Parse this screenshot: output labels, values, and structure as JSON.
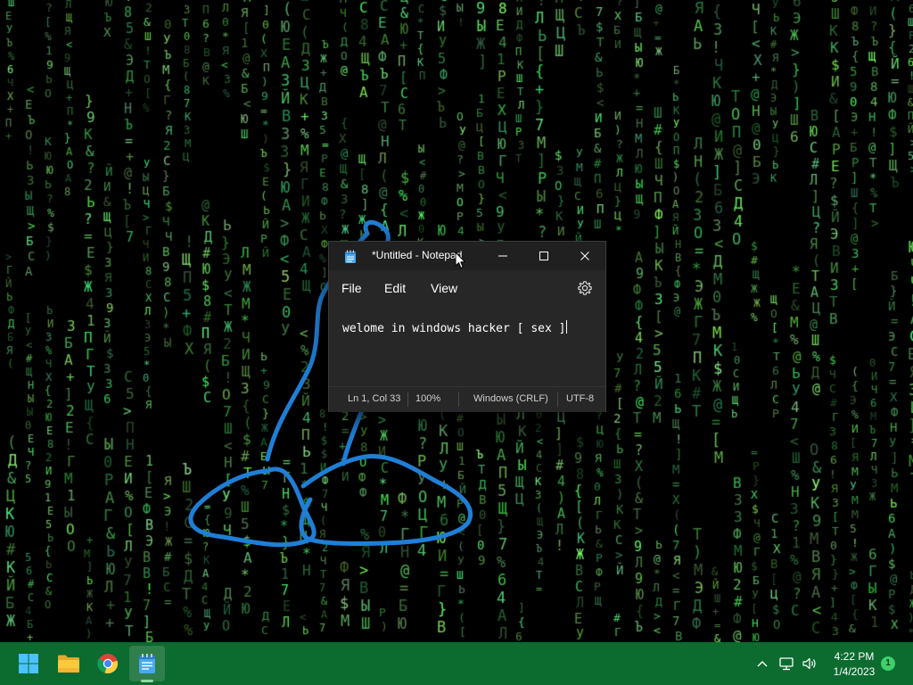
{
  "notepad": {
    "title": "*Untitled - Notepad",
    "menu": {
      "file": "File",
      "edit": "Edit",
      "view": "View"
    },
    "content": "welome in windows hacker [ sex ]",
    "status": {
      "position": "Ln 1, Col 33",
      "zoom": "100%",
      "line_ending": "Windows (CRLF)",
      "encoding": "UTF-8"
    }
  },
  "taskbar": {
    "pinned": [
      {
        "name": "start",
        "icon": "windows-logo-icon"
      },
      {
        "name": "file-explorer",
        "icon": "folder-icon"
      },
      {
        "name": "chrome",
        "icon": "chrome-icon"
      },
      {
        "name": "notepad",
        "icon": "notepad-icon",
        "active": true
      }
    ],
    "tray": {
      "time": "4:22 PM",
      "date": "1/4/2023",
      "notification_count": "1"
    }
  },
  "colors": {
    "taskbar": "#0c6b2f",
    "matrix_green": "#5cff7a",
    "ink_blue": "#1f7fd6",
    "window_bg": "#272727"
  }
}
